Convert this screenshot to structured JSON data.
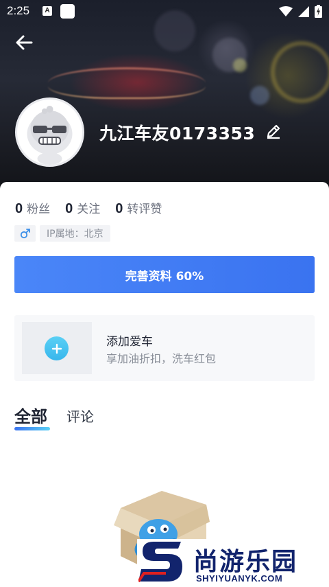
{
  "status_bar": {
    "time": "2:25",
    "icons": [
      "text-recognition-icon",
      "app-square-icon",
      "wifi-icon",
      "signal-icon",
      "battery-charging-icon"
    ]
  },
  "header": {
    "back_icon": "arrow-left-icon",
    "nickname": "九江车友0173353",
    "edit_icon": "pencil-icon"
  },
  "stats": [
    {
      "value": "0",
      "label": "粉丝"
    },
    {
      "value": "0",
      "label": "关注"
    },
    {
      "value": "0",
      "label": "转评赞"
    }
  ],
  "tags": {
    "gender_icon": "male-icon",
    "ip_location": "IP属地：北京"
  },
  "complete_profile_button": "完善资料 60%",
  "add_car": {
    "title": "添加爱车",
    "subtitle": "享加油折扣，洗车红包",
    "icon": "plus-circle-icon"
  },
  "tabs": [
    {
      "label": "全部",
      "active": true
    },
    {
      "label": "评论",
      "active": false
    }
  ],
  "watermark": {
    "brand": "尚游乐园",
    "url": "SHYIYUANYK.COM"
  },
  "colors": {
    "primary_blue": "#3a73f0",
    "accent_cyan": "#38b6ec",
    "text_dark": "#1f2433",
    "text_gray": "#8a8f99"
  }
}
